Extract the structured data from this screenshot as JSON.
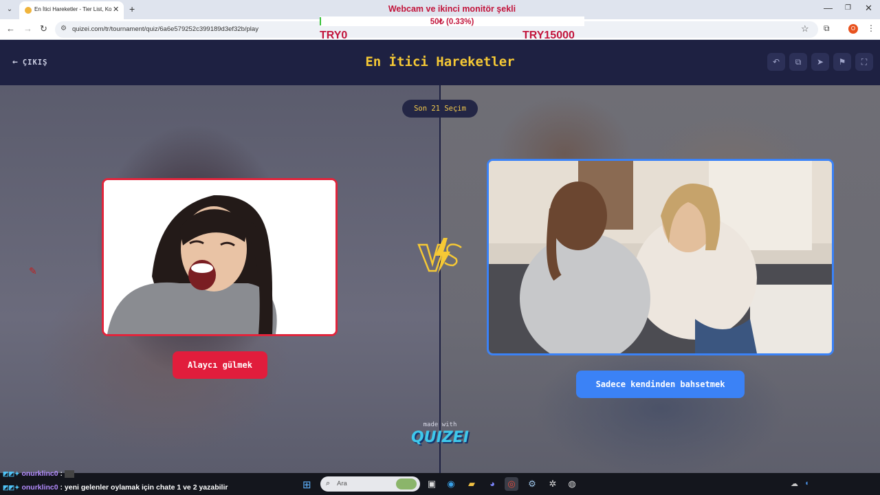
{
  "browser": {
    "tab_title": "En İtici Hareketler - Tier List, Ko",
    "url": "quizei.com/tr/tournament/quiz/6a6e579252c399189d3ef32b/play"
  },
  "overlay": {
    "title": "Webcam ve ikinci monitör şekli",
    "amount": "50₺ (0.33%)",
    "progress_fraction": 0.0033,
    "min_label": "TRY0",
    "max_label": "TRY15000"
  },
  "header": {
    "exit_label": "ÇIKIŞ",
    "title": "En İtici Hareketler"
  },
  "stage": {
    "round_badge": "Son 21 Seçim",
    "left_choice": "Alaycı gülmek",
    "right_choice": "Sadece kendinden bahsetmek",
    "made_with": "made with",
    "brand": "QUIZEI"
  },
  "chat": {
    "lines": [
      {
        "user": "onurklinc0",
        "message": ":"
      },
      {
        "user": "onurklinc0",
        "message": ": yeni gelenler oylamak için chate 1 ve 2 yazabilir"
      }
    ]
  },
  "taskbar": {
    "search_placeholder": "Ara"
  },
  "colors": {
    "accent_red": "#e11d3c",
    "accent_blue": "#3b82f6",
    "title_yellow": "#f6c935",
    "header_bg": "#1e2142"
  }
}
